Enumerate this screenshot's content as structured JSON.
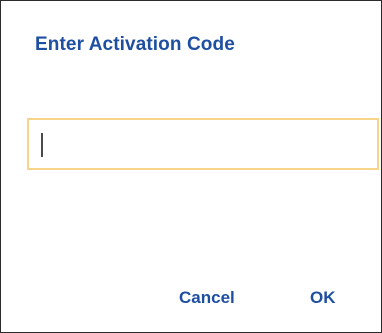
{
  "dialog": {
    "title": "Enter Activation Code",
    "input": {
      "value": "",
      "placeholder": ""
    },
    "buttons": {
      "cancel_label": "Cancel",
      "ok_label": "OK"
    }
  },
  "colors": {
    "accent": "#1f4fa0",
    "input_border_focus": "#f6d58a",
    "dialog_border": "#2b2b2b",
    "background": "#ffffff"
  }
}
